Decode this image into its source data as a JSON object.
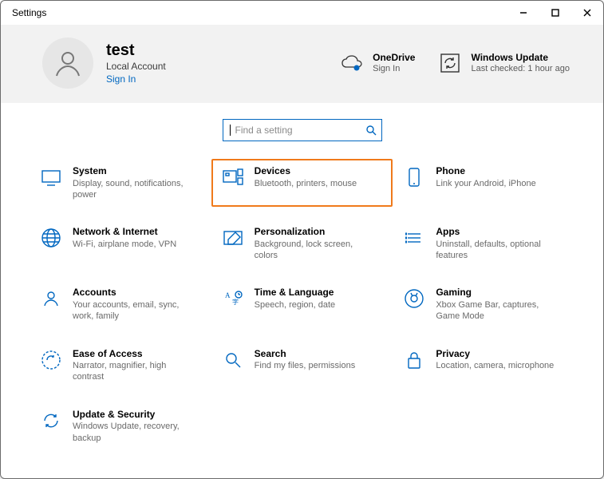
{
  "window": {
    "title": "Settings"
  },
  "user": {
    "name": "test",
    "subtitle": "Local Account",
    "signInLabel": "Sign In"
  },
  "headerTiles": {
    "onedrive": {
      "title": "OneDrive",
      "subtitle": "Sign In"
    },
    "update": {
      "title": "Windows Update",
      "subtitle": "Last checked: 1 hour ago"
    }
  },
  "search": {
    "placeholder": "Find a setting"
  },
  "categories": [
    {
      "id": "system",
      "title": "System",
      "desc": "Display, sound, notifications, power"
    },
    {
      "id": "devices",
      "title": "Devices",
      "desc": "Bluetooth, printers, mouse",
      "highlighted": true
    },
    {
      "id": "phone",
      "title": "Phone",
      "desc": "Link your Android, iPhone"
    },
    {
      "id": "network",
      "title": "Network & Internet",
      "desc": "Wi-Fi, airplane mode, VPN"
    },
    {
      "id": "personalization",
      "title": "Personalization",
      "desc": "Background, lock screen, colors"
    },
    {
      "id": "apps",
      "title": "Apps",
      "desc": "Uninstall, defaults, optional features"
    },
    {
      "id": "accounts",
      "title": "Accounts",
      "desc": "Your accounts, email, sync, work, family"
    },
    {
      "id": "time",
      "title": "Time & Language",
      "desc": "Speech, region, date"
    },
    {
      "id": "gaming",
      "title": "Gaming",
      "desc": "Xbox Game Bar, captures, Game Mode"
    },
    {
      "id": "ease",
      "title": "Ease of Access",
      "desc": "Narrator, magnifier, high contrast"
    },
    {
      "id": "search",
      "title": "Search",
      "desc": "Find my files, permissions"
    },
    {
      "id": "privacy",
      "title": "Privacy",
      "desc": "Location, camera, microphone"
    },
    {
      "id": "update",
      "title": "Update & Security",
      "desc": "Windows Update, recovery, backup"
    }
  ]
}
